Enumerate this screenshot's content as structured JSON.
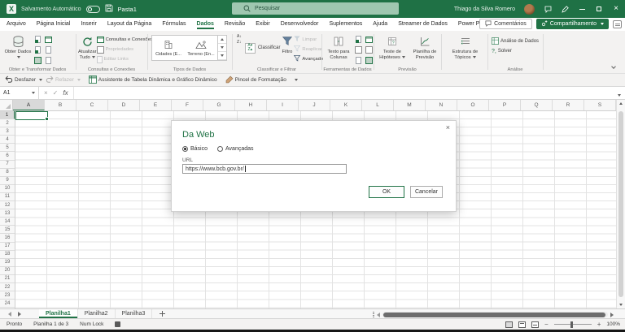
{
  "titlebar": {
    "autosave_label": "Salvamento Automático",
    "workbook_name": "Pasta1",
    "search_placeholder": "Pesquisar",
    "user_name": "Thiago da Silva Romero"
  },
  "menubar": {
    "tabs": [
      "Arquivo",
      "Página Inicial",
      "Inserir",
      "Layout da Página",
      "Fórmulas",
      "Dados",
      "Revisão",
      "Exibir",
      "Desenvolvedor",
      "Suplementos",
      "Ajuda",
      "Streamer de Dados",
      "Power Pivot"
    ],
    "active_tab": "Dados",
    "comments_label": "Comentários",
    "share_label": "Compartilhamento"
  },
  "quick_access": {
    "undo_label": "Desfazer",
    "redo_label": "Refazer",
    "pivot_wizard_label": "Assistente de Tabela Dinâmica e Gráfico Dinâmico",
    "format_painter_label": "Pincel de Formatação"
  },
  "ribbon": {
    "groups": {
      "get_transform": {
        "label": "Obter e Transformar Dados",
        "get_data": "Obter Dados"
      },
      "queries": {
        "label": "Consultas e Conexões",
        "refresh_all": "Atualizar Tudo",
        "queries_connections": "Consultas e Conexões",
        "properties": "Propriedades",
        "edit_links": "Editar Links"
      },
      "data_types": {
        "label": "Tipos de Dados",
        "items": [
          "Cidades (E...",
          "Terreno (En..."
        ]
      },
      "sort_filter": {
        "label": "Classificar e Filtrar",
        "sort": "Classificar",
        "filter": "Filtro",
        "clear": "Limpar",
        "reapply": "Reaplicar",
        "advanced": "Avançado"
      },
      "data_tools": {
        "label": "Ferramentas de Dados",
        "text_to_columns": "Texto para Colunas"
      },
      "forecast": {
        "label": "Previsão",
        "what_if": "Teste de Hipóteses",
        "forecast_sheet": "Planilha de Previsão"
      },
      "outline": {
        "label": "Estrutura de Tópicos"
      },
      "analysis": {
        "label": "Análise",
        "data_analysis": "Análise de Dados",
        "solver": "Solver"
      }
    }
  },
  "formula_bar": {
    "name_box": "A1"
  },
  "grid": {
    "columns": [
      "A",
      "B",
      "C",
      "D",
      "E",
      "F",
      "G",
      "H",
      "I",
      "J",
      "K",
      "L",
      "M",
      "N",
      "O",
      "P",
      "Q",
      "R",
      "S"
    ],
    "row_count": 24,
    "selected_cell": "A1"
  },
  "dialog": {
    "title": "Da Web",
    "basic_label": "Básico",
    "advanced_label": "Avançadas",
    "selected_option": "Básico",
    "url_label": "URL",
    "url_value": "https://www.bcb.gov.br/",
    "ok_label": "OK",
    "cancel_label": "Cancelar"
  },
  "sheet_tabs": {
    "tabs": [
      "Planilha1",
      "Planilha2",
      "Planilha3"
    ],
    "active_tab": "Planilha1"
  },
  "status_bar": {
    "mode": "Pronto",
    "sheet_info": "Planilha 1 de 3",
    "num_lock": "Num Lock",
    "zoom_level": "100%"
  }
}
